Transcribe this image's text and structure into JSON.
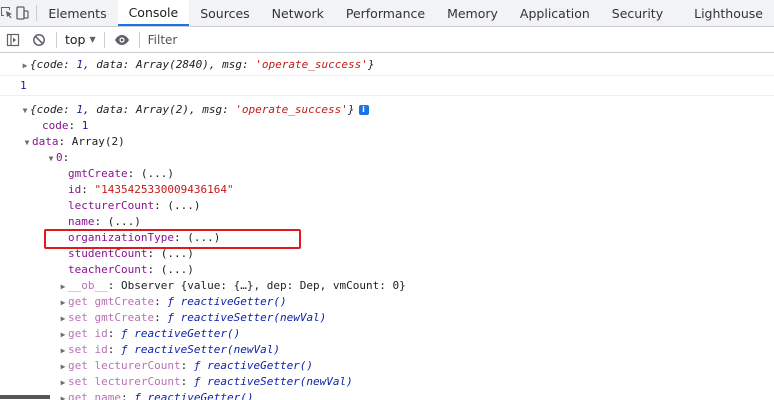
{
  "tabs": [
    "Elements",
    "Console",
    "Sources",
    "Network",
    "Performance",
    "Memory",
    "Application",
    "Security",
    "Lighthouse"
  ],
  "active_tab": "Console",
  "toolbar": {
    "context": "top",
    "filter_placeholder": "Filter"
  },
  "console": {
    "msg1": {
      "open": "{",
      "code_key": "code",
      "code_val": "1",
      "data_key": "data",
      "data_val": "Array(2840)",
      "msg_key": "msg",
      "msg_val": "'operate_success'",
      "close": "}"
    },
    "msg2": {
      "value": "1"
    },
    "msg3": {
      "header": {
        "code_val": "1",
        "data_val": "Array(2)",
        "msg_val": "'operate_success'",
        "info": "i"
      },
      "code_line": {
        "key": "code",
        "val": "1"
      },
      "data_line": {
        "key": "data",
        "val": "Array(2)"
      },
      "item0": "0",
      "props": [
        {
          "key": "gmtCreate",
          "val": "(...)"
        },
        {
          "key": "id",
          "val": "\"1435425330009436164\""
        },
        {
          "key": "lecturerCount",
          "val": "(...)"
        },
        {
          "key": "name",
          "val": "(...)"
        },
        {
          "key": "organizationType",
          "val": "(...)"
        },
        {
          "key": "studentCount",
          "val": "(...)"
        },
        {
          "key": "teacherCount",
          "val": "(...)"
        }
      ],
      "ob": {
        "key": "__ob__",
        "val": "Observer {value: {…}, dep: Dep, vmCount: 0}"
      },
      "accessors": [
        {
          "kind": "get",
          "key": "gmtCreate",
          "fn": "reactiveGetter()"
        },
        {
          "kind": "set",
          "key": "gmtCreate",
          "fn": "reactiveSetter(newVal)"
        },
        {
          "kind": "get",
          "key": "id",
          "fn": "reactiveGetter()"
        },
        {
          "kind": "set",
          "key": "id",
          "fn": "reactiveSetter(newVal)"
        },
        {
          "kind": "get",
          "key": "lecturerCount",
          "fn": "reactiveGetter()"
        },
        {
          "kind": "set",
          "key": "lecturerCount",
          "fn": "reactiveSetter(newVal)"
        },
        {
          "kind": "get",
          "key": "name",
          "fn": "reactiveGetter()"
        }
      ]
    }
  },
  "colors": {
    "accent": "#1a73e8",
    "highlight": "#e0191f",
    "string": "#c41a16",
    "number": "#1a1aa6",
    "key": "#881391"
  }
}
